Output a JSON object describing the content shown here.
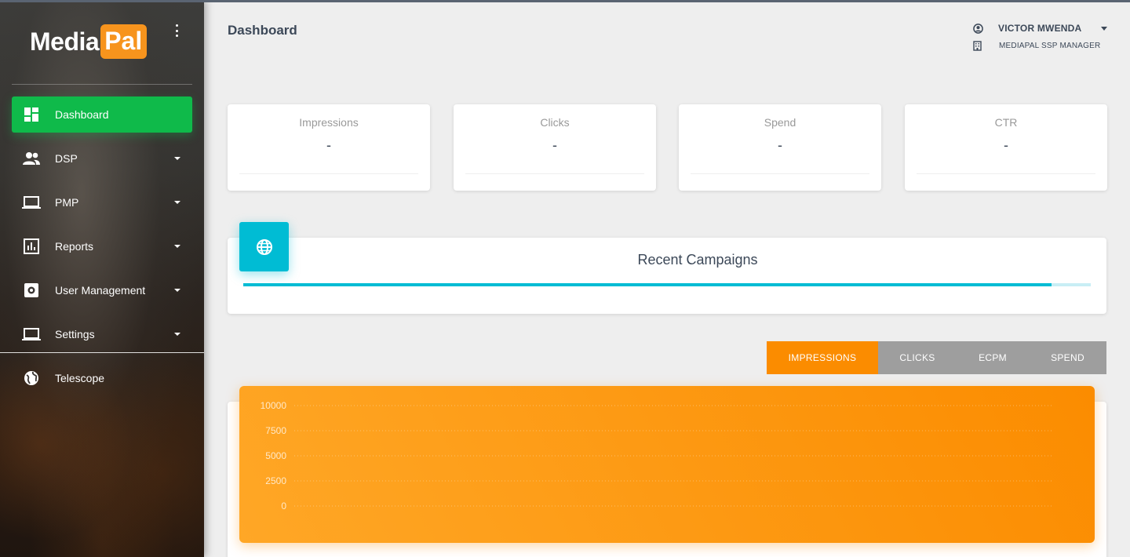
{
  "app": {
    "logo_part1": "Media",
    "logo_part2": "Pal",
    "brand_color": "#f7941d"
  },
  "sidebar": {
    "items": [
      {
        "label": "Dashboard",
        "icon": "dashboard-icon",
        "active": true,
        "has_caret": false
      },
      {
        "label": "DSP",
        "icon": "people-icon",
        "active": false,
        "has_caret": true
      },
      {
        "label": "PMP",
        "icon": "laptop-icon",
        "active": false,
        "has_caret": true
      },
      {
        "label": "Reports",
        "icon": "bar-chart-icon",
        "active": false,
        "has_caret": true
      },
      {
        "label": "User Management",
        "icon": "settings-box-icon",
        "active": false,
        "has_caret": true
      },
      {
        "label": "Settings",
        "icon": "laptop-icon",
        "active": false,
        "has_caret": true
      },
      {
        "label": "Telescope",
        "icon": "globe-icon",
        "active": false,
        "has_caret": false
      }
    ],
    "active_color": "#0fba4a"
  },
  "header": {
    "title": "Dashboard",
    "user_name": "VICTOR MWENDA",
    "user_role": "MEDIAPAL SSP MANAGER"
  },
  "stats": [
    {
      "label": "Impressions",
      "value": "-"
    },
    {
      "label": "Clicks",
      "value": "-"
    },
    {
      "label": "Spend",
      "value": "-"
    },
    {
      "label": "CTR",
      "value": "-"
    }
  ],
  "campaigns": {
    "title": "Recent Campaigns",
    "progress": 0.954,
    "accent": "#00bcd4"
  },
  "metric_tabs": [
    {
      "label": "IMPRESSIONS",
      "active": true
    },
    {
      "label": "CLICKS",
      "active": false
    },
    {
      "label": "ECPM",
      "active": false
    },
    {
      "label": "SPEND",
      "active": false
    }
  ],
  "chart_data": {
    "type": "line",
    "title": "",
    "xlabel": "",
    "ylabel": "",
    "ylim": [
      0,
      10000
    ],
    "yticks": [
      "10000",
      "7500",
      "5000",
      "2500",
      "0"
    ],
    "series": [],
    "grid": true,
    "background": "#fb8c00"
  }
}
